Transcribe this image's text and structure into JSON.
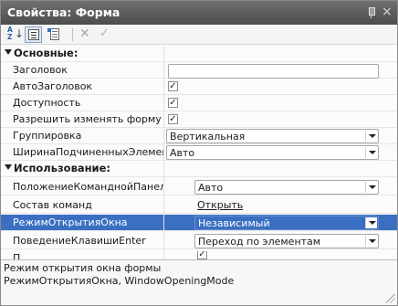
{
  "window": {
    "title": "Свойства: Форма",
    "pin_icon": "pin-icon",
    "close_glyph": "×"
  },
  "toolbar": {
    "buttons": [
      {
        "name": "sort-alphabetical",
        "icon": "sort-az-icon",
        "label": "A Z",
        "active": false
      },
      {
        "name": "categorized",
        "icon": "categorized-icon",
        "active": true
      },
      {
        "name": "description",
        "icon": "document-icon",
        "active": false
      },
      {
        "name": "clear",
        "icon": "x-icon",
        "glyph": "✕",
        "enabled": false
      },
      {
        "name": "apply",
        "icon": "check-icon",
        "glyph": "✓",
        "enabled": false
      }
    ]
  },
  "groups": {
    "main": "Основные:",
    "usage": "Использование:"
  },
  "properties": {
    "zagolovok": {
      "label": "Заголовок",
      "value": ""
    },
    "avto_zagolovok": {
      "label": "АвтоЗаголовок",
      "checked": true
    },
    "dostupnost": {
      "label": "Доступность",
      "checked": true
    },
    "razreshit": {
      "label": "Разрешить изменять форму",
      "checked": true
    },
    "gruppirovka": {
      "label": "Группировка",
      "value": "Вертикальная"
    },
    "shirina": {
      "label": "ШиринаПодчиненныхЭлементов",
      "value": "Авто"
    },
    "polozhenie": {
      "label": "ПоложениеКоманднойПанели",
      "value": "Авто"
    },
    "sostav": {
      "label": "Состав команд",
      "value": "Открыть"
    },
    "rezhim": {
      "label": "РежимОткрытияОкна",
      "value": "Независимый",
      "selected": true
    },
    "povedenie": {
      "label": "ПоведениеКлавишиEnter",
      "value": "Переход по элементам"
    },
    "partial_row": {
      "label": "П",
      "checked": true
    }
  },
  "description": {
    "line1": "Режим открытия окна формы",
    "line2": "РежимОткрытияОкна, WindowOpeningMode"
  },
  "colors": {
    "titlebar": "#5c5c5c",
    "selection": "#3a6fc2"
  }
}
